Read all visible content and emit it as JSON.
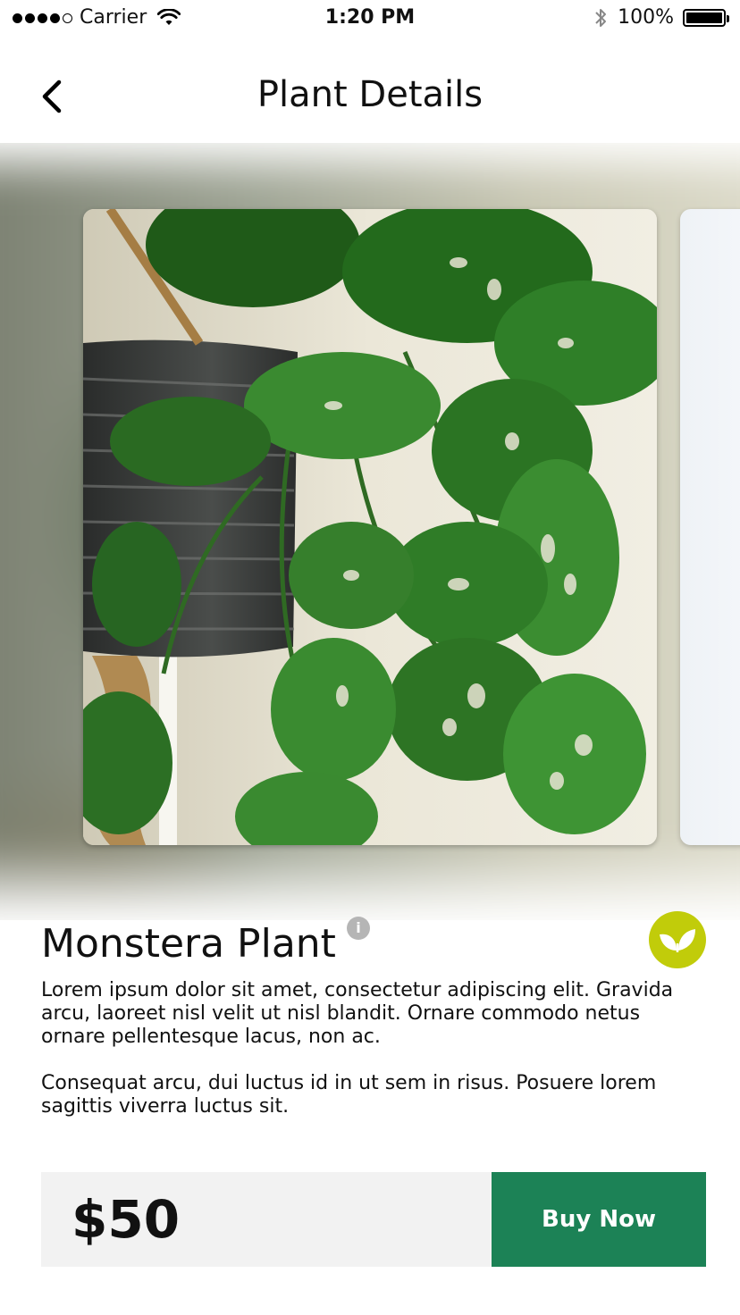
{
  "status_bar": {
    "carrier": "Carrier",
    "time": "1:20 PM",
    "battery_percent": "100%",
    "signal_bars_filled": 4,
    "signal_bars_total": 5,
    "battery_level": 1.0
  },
  "header": {
    "title": "Plant Details",
    "back_icon": "chevron-left-icon"
  },
  "carousel": {
    "current_image": "monstera-plant-photo",
    "next_image_partially_visible": true
  },
  "product": {
    "name": "Monstera Plant",
    "info_icon": "info-icon",
    "badge_icon": "leaf-icon",
    "badge_color": "#c1cc0a",
    "description": [
      "Lorem ipsum dolor sit amet, consectetur adipiscing elit. Gravida arcu, laoreet nisl velit ut nisl blandit. Ornare commodo netus ornare pellentesque lacus, non ac.",
      "Consequat arcu, dui luctus id in ut sem in risus. Posuere lorem sagittis viverra luctus sit."
    ]
  },
  "purchase": {
    "price": "$50",
    "buy_label": "Buy Now",
    "buy_color": "#1c8256"
  }
}
